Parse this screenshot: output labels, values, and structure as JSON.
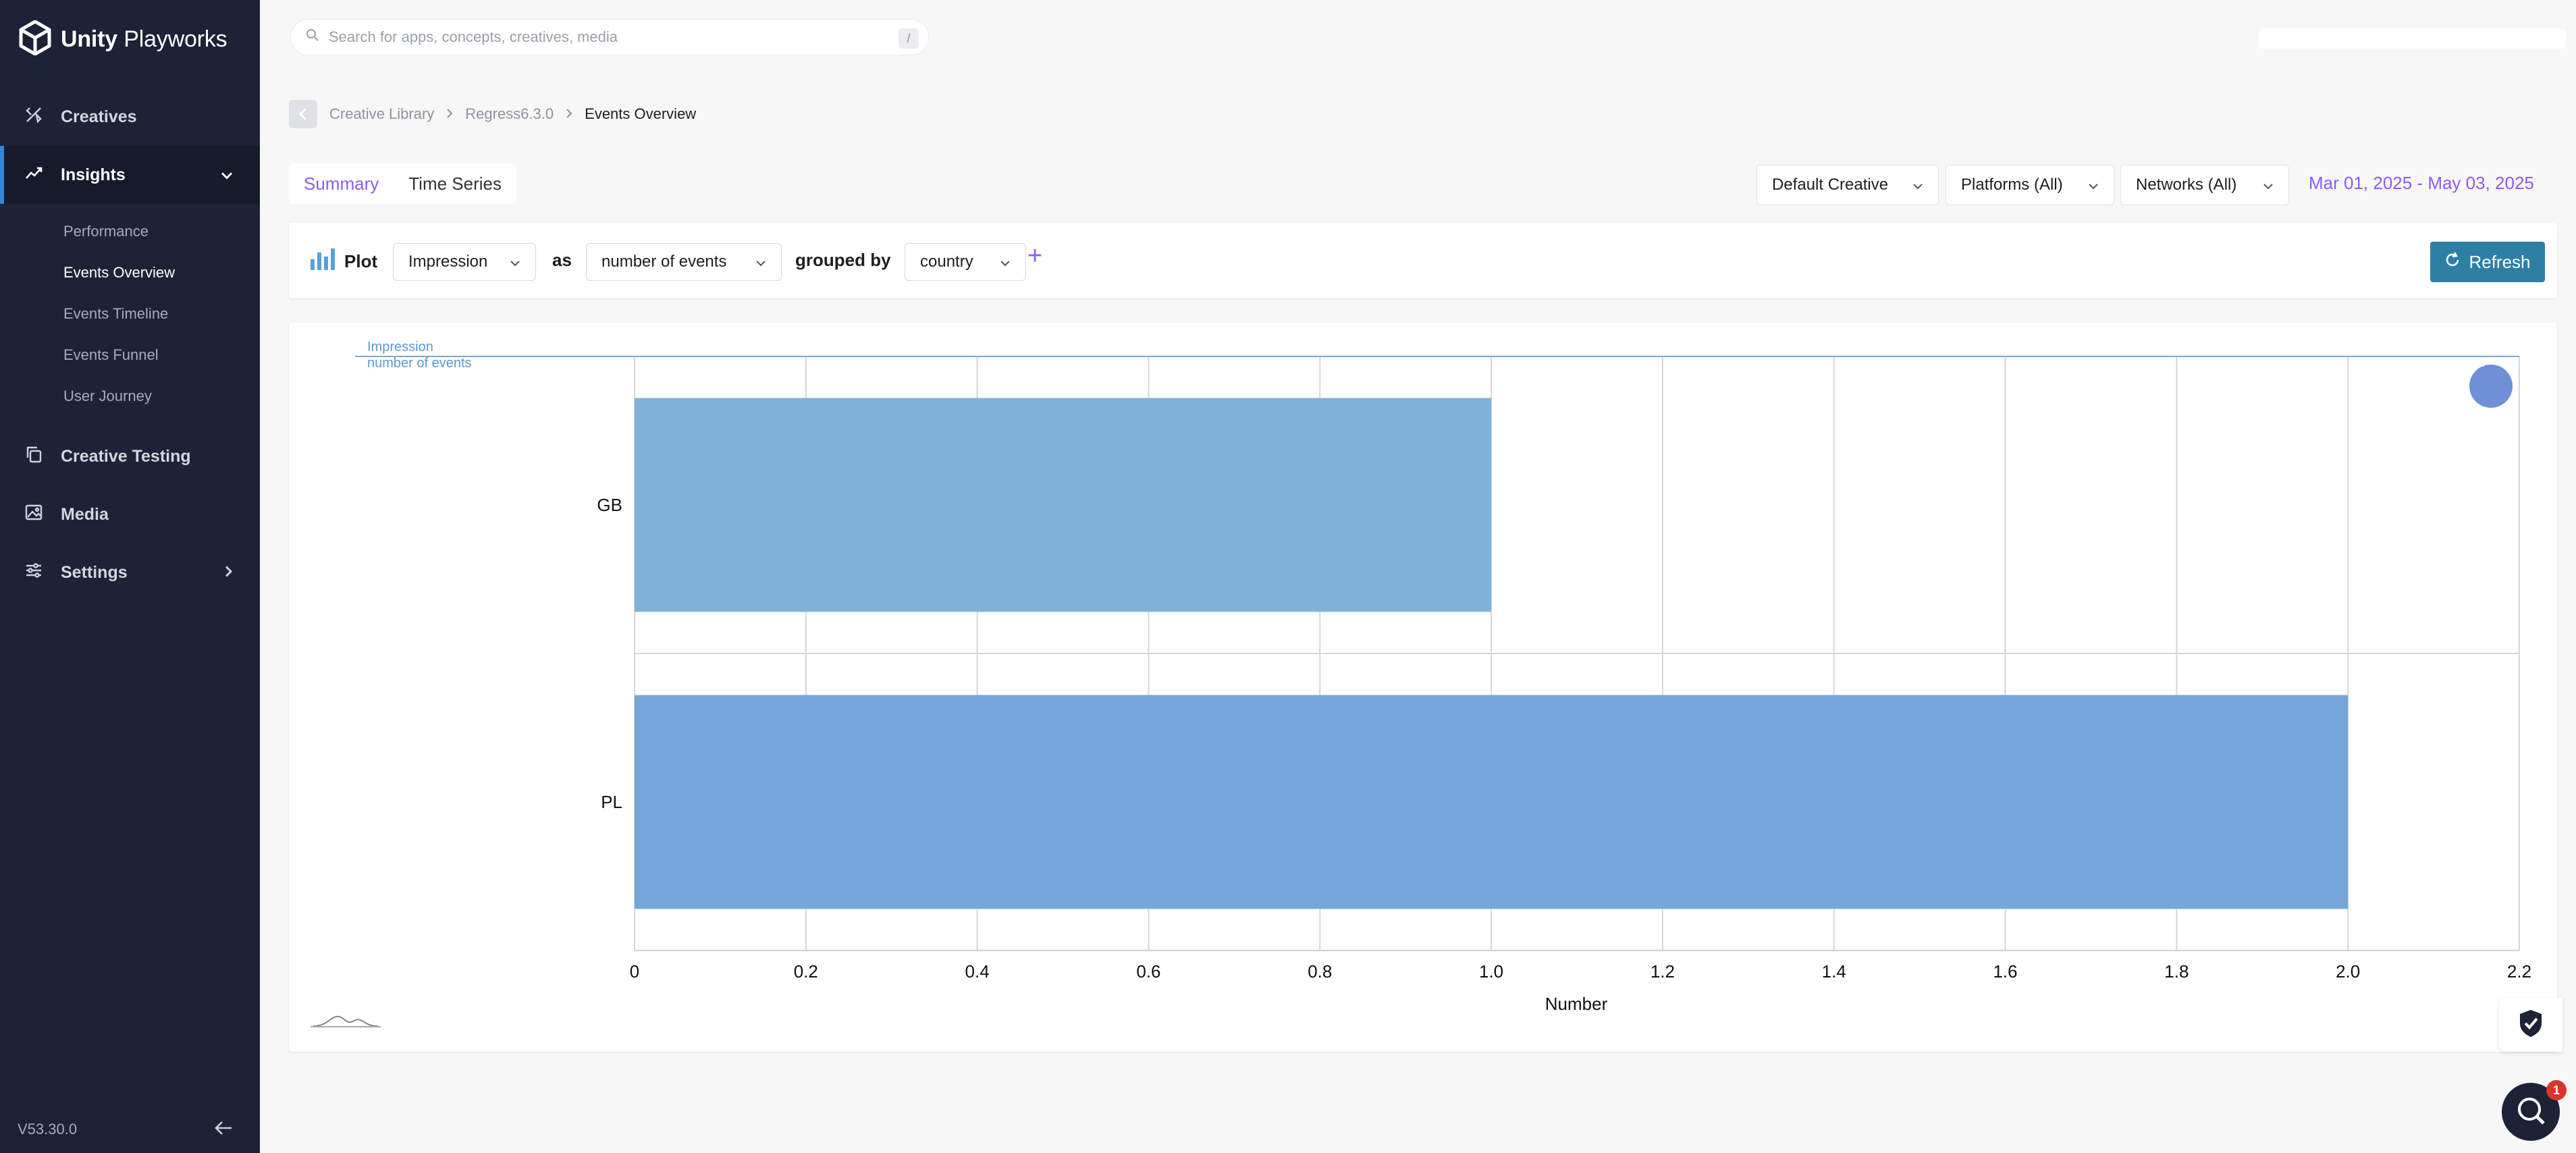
{
  "app": {
    "logo_bold": "Unity",
    "logo_rest": " Playworks",
    "version": "V53.30.0"
  },
  "sidebar": {
    "items": [
      {
        "label": "Creatives"
      },
      {
        "label": "Insights"
      },
      {
        "label": "Creative Testing"
      },
      {
        "label": "Media"
      },
      {
        "label": "Settings"
      }
    ],
    "insights_sub": [
      {
        "label": "Performance"
      },
      {
        "label": "Events Overview"
      },
      {
        "label": "Events Timeline"
      },
      {
        "label": "Events Funnel"
      },
      {
        "label": "User Journey"
      }
    ]
  },
  "search": {
    "placeholder": "Search for apps, concepts, creatives, media",
    "shortcut": "/"
  },
  "breadcrumb": {
    "items": [
      "Creative Library",
      "Regress6.3.0",
      "Events Overview"
    ]
  },
  "tabs": [
    {
      "label": "Summary"
    },
    {
      "label": "Time Series"
    }
  ],
  "filters": {
    "creative": "Default Creative",
    "platforms": "Platforms (All)",
    "networks": "Networks (All)",
    "date_range": "Mar 01, 2025 - May 03, 2025"
  },
  "plot_controls": {
    "plot_label": "Plot",
    "event": "Impression",
    "as_label": "as",
    "metric": "number of events",
    "grouped_by_label": "grouped by",
    "group": "country",
    "add": "+",
    "refresh": "Refresh"
  },
  "chart_data": {
    "type": "bar",
    "orientation": "horizontal",
    "legend": [
      "Impression",
      "number of events"
    ],
    "categories": [
      "GB",
      "PL"
    ],
    "values": [
      1,
      2
    ],
    "xlabel": "Number",
    "ylabel": "",
    "xlim": [
      0,
      2.2
    ],
    "x_ticks": [
      "0",
      "0.2",
      "0.4",
      "0.6",
      "0.8",
      "1.0",
      "1.2",
      "1.4",
      "1.6",
      "1.8",
      "2.0",
      "2.2"
    ],
    "grid": true,
    "colors": [
      "#7fb2da",
      "#75a6da"
    ]
  },
  "floating": {
    "chat_badge": "1"
  }
}
